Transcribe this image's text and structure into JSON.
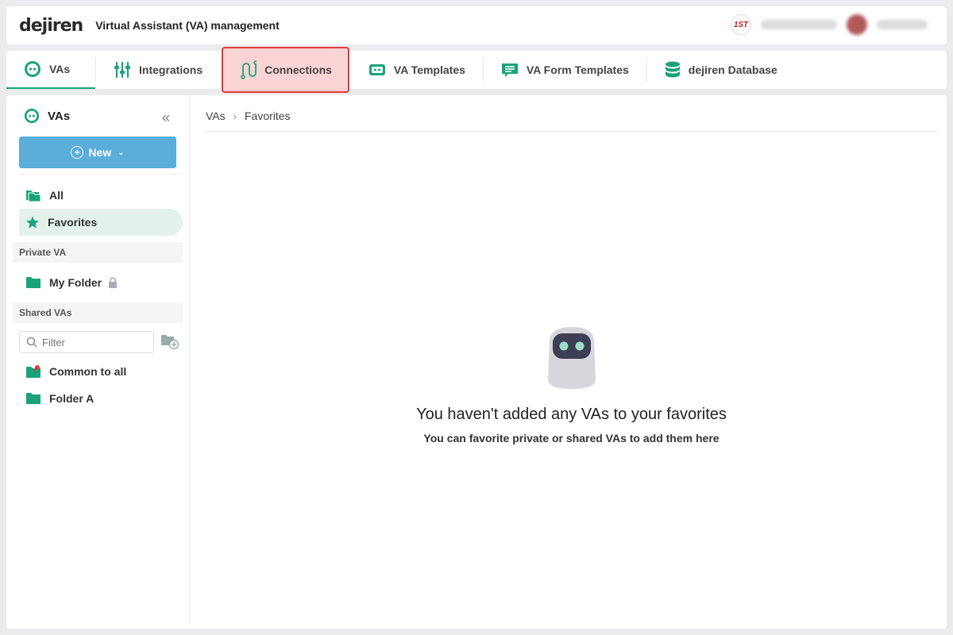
{
  "header": {
    "logo": "dejiren",
    "title": "Virtual Assistant (VA) management",
    "org_badge": "1ST"
  },
  "tabs": [
    {
      "label": "VAs",
      "icon": "robot-icon"
    },
    {
      "label": "Integrations",
      "icon": "sliders-icon"
    },
    {
      "label": "Connections",
      "icon": "connections-icon"
    },
    {
      "label": "VA Templates",
      "icon": "template-icon"
    },
    {
      "label": "VA Form Templates",
      "icon": "form-template-icon"
    },
    {
      "label": "dejiren Database",
      "icon": "database-icon"
    }
  ],
  "sidebar": {
    "title": "VAs",
    "new_button": "New",
    "items": {
      "all": "All",
      "favorites": "Favorites"
    },
    "private_section": "Private VA",
    "my_folder": "My Folder",
    "shared_section": "Shared VAs",
    "filter_placeholder": "Filter",
    "common_to_all": "Common to all",
    "folder_a": "Folder A"
  },
  "breadcrumb": {
    "root": "VAs",
    "current": "Favorites"
  },
  "empty_state": {
    "title": "You haven't added any VAs to your favorites",
    "subtitle": "You can favorite private or shared VAs to add them here"
  },
  "colors": {
    "accent": "#1aa37a",
    "button": "#5aaed9",
    "highlight_border": "#e23a3a",
    "highlight_fill": "#fcd4d4"
  }
}
